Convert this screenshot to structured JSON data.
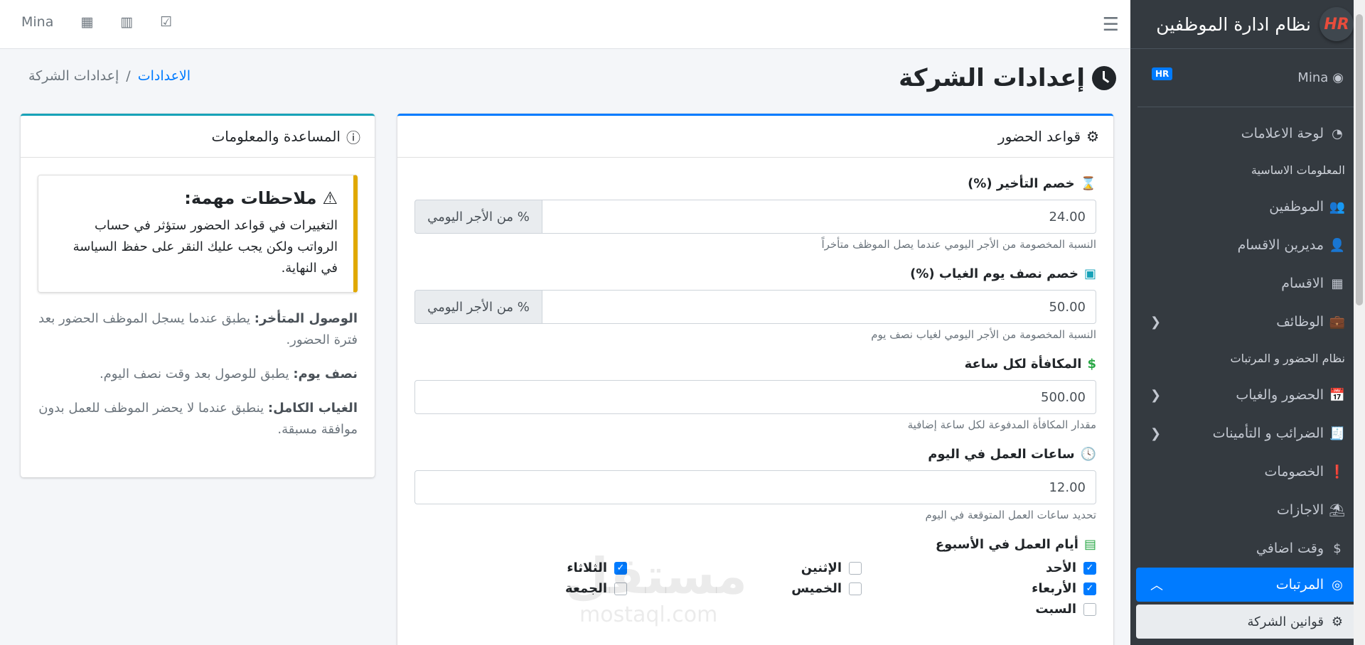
{
  "brand": {
    "title": "نظام ادارة الموظفين",
    "logo": "HR"
  },
  "user": {
    "name": "Mina",
    "badge": "HR"
  },
  "sidebar": {
    "items": [
      {
        "type": "item",
        "label": "لوحة الاعلامات",
        "icon": "dashboard-icon",
        "glyph": "◔"
      },
      {
        "type": "header",
        "label": "المعلومات الاساسية"
      },
      {
        "type": "item",
        "label": "الموظفين",
        "icon": "users-icon",
        "glyph": "👥"
      },
      {
        "type": "item",
        "label": "مديرين الاقسام",
        "icon": "user-icon",
        "glyph": "👤"
      },
      {
        "type": "item",
        "label": "الاقسام",
        "icon": "building-icon",
        "glyph": "▦"
      },
      {
        "type": "item",
        "label": "الوظائف",
        "icon": "briefcase-icon",
        "glyph": "💼",
        "chevron": "❮"
      },
      {
        "type": "header",
        "label": "نظام الحضور و المرتبات"
      },
      {
        "type": "item",
        "label": "الحضور والغياب",
        "icon": "calendar-check-icon",
        "glyph": "📅",
        "chevron": "❮"
      },
      {
        "type": "item",
        "label": "الضرائب و التأمينات",
        "icon": "invoice-icon",
        "glyph": "🧾",
        "chevron": "❮"
      },
      {
        "type": "item",
        "label": "الخصومات",
        "icon": "exclamation-icon",
        "glyph": "❗"
      },
      {
        "type": "item",
        "label": "الاجازات",
        "icon": "umbrella-beach-icon",
        "glyph": "⛱"
      },
      {
        "type": "item",
        "label": "وقت اضافي",
        "icon": "dollar-icon",
        "glyph": "$"
      },
      {
        "type": "active",
        "label": "المرتبات",
        "icon": "coins-icon",
        "glyph": "◎",
        "chevron": "︿"
      },
      {
        "type": "sub-active",
        "label": "قوانين الشركة",
        "icon": "gears-icon",
        "glyph": "⚙"
      }
    ]
  },
  "topbar": {
    "user": "Mina"
  },
  "page": {
    "title": "إعدادات الشركة"
  },
  "breadcrumb": {
    "link": "الاعدادات",
    "separator": "/",
    "current": "إعدادات الشركة"
  },
  "attendance": {
    "header": "قواعد الحضور",
    "late": {
      "label": "خصم التأخير (%)",
      "value": "24.00",
      "addon": "% من الأجر اليومي",
      "help": "النسبة المخصومة من الأجر اليومي عندما يصل الموظف متأخراً"
    },
    "halfday": {
      "label": "خصم نصف يوم الغياب (%)",
      "value": "50.00",
      "addon": "% من الأجر اليومي",
      "help": "النسبة المخصومة من الأجر اليومي لغياب نصف يوم"
    },
    "bonus": {
      "label": "المكافأة لكل ساعة",
      "value": "500.00",
      "help": "مقدار المكافأة المدفوعة لكل ساعة إضافية"
    },
    "hours": {
      "label": "ساعات العمل في اليوم",
      "value": "12.00",
      "help": "تحديد ساعات العمل المتوقعة في اليوم"
    },
    "days_label": "أيام العمل في الأسبوع",
    "days": [
      {
        "label": "الأحد",
        "checked": true
      },
      {
        "label": "الإثنين",
        "checked": false
      },
      {
        "label": "الثلاثاء",
        "checked": true
      },
      {
        "label": "الأربعاء",
        "checked": true
      },
      {
        "label": "الخميس",
        "checked": false
      },
      {
        "label": "الجمعة",
        "checked": false
      },
      {
        "label": "السبت",
        "checked": false
      }
    ]
  },
  "help": {
    "header": "المساعدة والمعلومات",
    "alert_title": "ملاحظات مهمة:",
    "alert_text": "التغييرات في قواعد الحضور ستؤثر في حساب الرواتب ولكن يجب عليك النقر على حفظ السياسة في النهاية.",
    "late_term": "الوصول المتأخر:",
    "late_desc": "يطبق عندما يسجل الموظف الحضور بعد فترة الحضور.",
    "half_term": "نصف يوم:",
    "half_desc": "يطبق للوصول بعد وقت نصف اليوم.",
    "absent_term": "الغياب الكامل:",
    "absent_desc": "ينطبق عندما لا يحضر الموظف للعمل بدون موافقة مسبقة."
  },
  "watermark": {
    "text": "مستقل",
    "sub": "mostaql.com"
  },
  "colors": {
    "primary": "#007bff",
    "sidebar": "#343a40",
    "warning": "#e0a800",
    "info": "#17a2b8",
    "success": "#28a745"
  }
}
